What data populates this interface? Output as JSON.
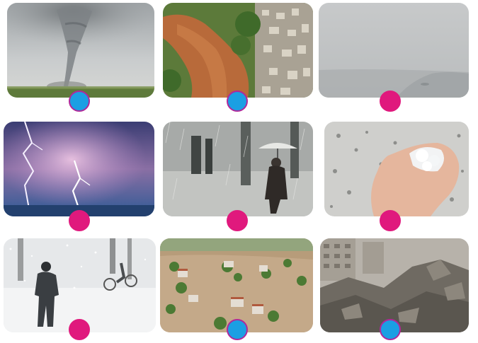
{
  "grid": {
    "photos": [
      {
        "subject": "tornado",
        "marker": "blue"
      },
      {
        "subject": "landslide",
        "marker": "blue"
      },
      {
        "subject": "fog",
        "marker": "magenta"
      },
      {
        "subject": "lightning-storm",
        "marker": "magenta"
      },
      {
        "subject": "heavy-rain",
        "marker": "magenta"
      },
      {
        "subject": "hail",
        "marker": "magenta"
      },
      {
        "subject": "snowstorm",
        "marker": "magenta"
      },
      {
        "subject": "flood",
        "marker": "blue"
      },
      {
        "subject": "earthquake-rubble",
        "marker": "blue"
      }
    ]
  },
  "colors": {
    "marker_blue": "#1b9fe3",
    "marker_blue_border": "#b0289a",
    "marker_magenta": "#e0197d"
  }
}
